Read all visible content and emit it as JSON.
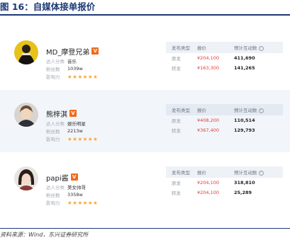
{
  "figure": {
    "title": "图 16：自媒体接单报价",
    "source": "资料来源：Wind，东兴证券研究所"
  },
  "colors": {
    "title_blue": "#1d3a75",
    "price_red": "#e53935",
    "badge_orange": "#f26a1b",
    "star_orange": "#f4a93c"
  },
  "labels": {
    "category": "达人分类",
    "fans": "粉丝数",
    "influence": "影响力",
    "col_type": "发布类型",
    "col_price": "报价",
    "col_interaction": "预计互动数",
    "badge": "V",
    "info": "i",
    "stars": "★★★★★★"
  },
  "creators": [
    {
      "name": "MD_摩登兄弟",
      "category": "音乐",
      "fans": "1039w",
      "rows": [
        {
          "type": "原发",
          "price": "¥204,100",
          "interaction": "411,690"
        },
        {
          "type": "转发",
          "price": "¥163,300",
          "interaction": "141,265"
        }
      ]
    },
    {
      "name": "熊梓淇",
      "category": "娱乐明星",
      "fans": "2213w",
      "rows": [
        {
          "type": "原发",
          "price": "¥408,200",
          "interaction": "110,514"
        },
        {
          "type": "转发",
          "price": "¥367,400",
          "interaction": "129,793"
        }
      ]
    },
    {
      "name": "papi酱",
      "category": "美女帅哥",
      "fans": "3358w",
      "rows": [
        {
          "type": "原发",
          "price": "¥204,100",
          "interaction": "318,810"
        },
        {
          "type": "转发",
          "price": "¥204,100",
          "interaction": "25,289"
        }
      ]
    }
  ]
}
